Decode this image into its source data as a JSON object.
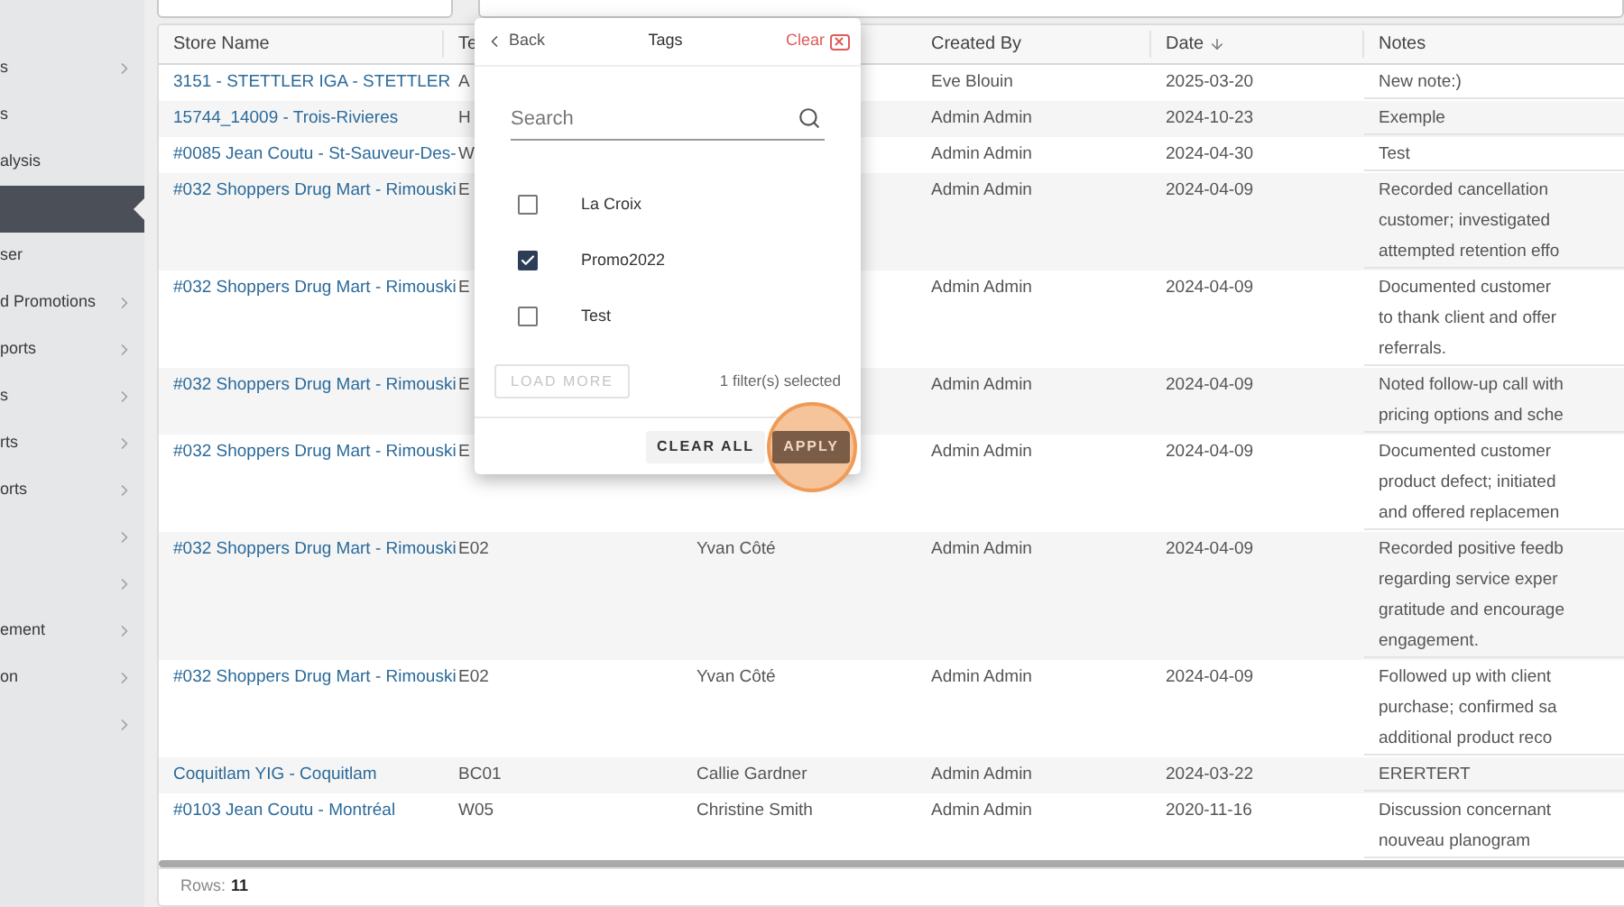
{
  "sidebar": {
    "items": [
      {
        "label": "s",
        "chevron": true,
        "selected": false
      },
      {
        "label": "s",
        "chevron": false,
        "selected": false
      },
      {
        "label": "alysis",
        "chevron": false,
        "selected": false
      },
      {
        "chevron": false,
        "selected": true
      },
      {
        "label": "ser",
        "chevron": false,
        "selected": false
      },
      {
        "label": "d Promotions",
        "chevron": true,
        "selected": false
      },
      {
        "label": "ports",
        "chevron": true,
        "selected": false
      },
      {
        "label": "s",
        "chevron": true,
        "selected": false
      },
      {
        "label": "rts",
        "chevron": true,
        "selected": false
      },
      {
        "label": "orts",
        "chevron": true,
        "selected": false
      },
      {
        "chevron": true,
        "selected": false
      },
      {
        "chevron": true,
        "selected": false
      },
      {
        "label": "ement",
        "chevron": true,
        "selected": false
      },
      {
        "label": "on",
        "chevron": true,
        "selected": false
      },
      {
        "chevron": true,
        "selected": false
      }
    ]
  },
  "table": {
    "columns": [
      {
        "label": "Store Name"
      },
      {
        "label": "Te"
      },
      {},
      {
        "label": "Created By"
      },
      {
        "label": "Date",
        "sorted_descending": true
      },
      {
        "label": "Notes"
      }
    ],
    "rows": [
      {
        "store": "3151 - STETTLER IGA - STETTLER",
        "team": "A",
        "created_by": "Eve Blouin",
        "date": "2025-03-20",
        "notes": [
          "New note:)"
        ]
      },
      {
        "store": "15744_14009 - Trois-Rivieres",
        "team": "H",
        "created_by": "Admin Admin",
        "date": "2024-10-23",
        "notes": [
          "Exemple"
        ]
      },
      {
        "store": "#0085 Jean Coutu - St-Sauveur-Des-",
        "team": "W",
        "created_by": "Admin Admin",
        "date": "2024-04-30",
        "notes": [
          "Test"
        ]
      },
      {
        "store": "#032 Shoppers Drug Mart - Rimouski",
        "team": "E",
        "created_by": "Admin Admin",
        "date": "2024-04-09",
        "notes": [
          "Recorded cancellation",
          "customer; investigated",
          "attempted retention effo"
        ]
      },
      {
        "store": "#032 Shoppers Drug Mart - Rimouski",
        "team": "E",
        "created_by": "Admin Admin",
        "date": "2024-04-09",
        "notes": [
          "Documented customer",
          "to thank client and offer",
          "referrals."
        ]
      },
      {
        "store": "#032 Shoppers Drug Mart - Rimouski",
        "team": "E",
        "created_by": "Admin Admin",
        "date": "2024-04-09",
        "notes": [
          "Noted follow-up call with",
          "pricing options and sche"
        ]
      },
      {
        "store": "#032 Shoppers Drug Mart - Rimouski",
        "team": "E",
        "created_by": "Admin Admin",
        "date": "2024-04-09",
        "notes": [
          "Documented customer",
          "product defect; initiated",
          "and offered replacemen"
        ]
      },
      {
        "store": "#032 Shoppers Drug Mart - Rimouski",
        "team": "E02",
        "column_3": "Yvan Côté",
        "created_by": "Admin Admin",
        "date": "2024-04-09",
        "notes": [
          "Recorded positive feedb",
          "regarding service exper",
          "gratitude and encourage",
          "engagement."
        ]
      },
      {
        "store": "#032 Shoppers Drug Mart - Rimouski",
        "team": "E02",
        "column_3": "Yvan Côté",
        "created_by": "Admin Admin",
        "date": "2024-04-09",
        "notes": [
          "Followed up with client",
          "purchase; confirmed sa",
          "additional product reco"
        ]
      },
      {
        "store": "Coquitlam YIG - Coquitlam",
        "team": "BC01",
        "column_3": "Callie Gardner",
        "created_by": "Admin Admin",
        "date": "2024-03-22",
        "notes": [
          "ERERTERT"
        ]
      },
      {
        "store": "#0103 Jean Coutu - Montréal",
        "team": "W05",
        "column_3": "Christine Smith",
        "created_by": "Admin Admin",
        "date": "2020-11-16",
        "notes": [
          "Discussion concernant",
          "nouveau planogram"
        ]
      }
    ],
    "footer": {
      "label": "Rows:",
      "count": "11"
    }
  },
  "filter_popup": {
    "back": "Back",
    "title": "Tags",
    "clear": "Clear",
    "search": {
      "placeholder": "Search"
    },
    "options": [
      {
        "label": "La Croix",
        "checked": false
      },
      {
        "label": "Promo2022",
        "checked": true
      },
      {
        "label": "Test",
        "checked": false
      }
    ],
    "load_more": {
      "label": "LOAD MORE",
      "disabled": true
    },
    "status": "1 filter(s) selected",
    "buttons": [
      {
        "label": "CLEAR ALL",
        "kind": "secondary"
      },
      {
        "label": "APPLY",
        "kind": "primary",
        "highlighted": true
      }
    ]
  }
}
